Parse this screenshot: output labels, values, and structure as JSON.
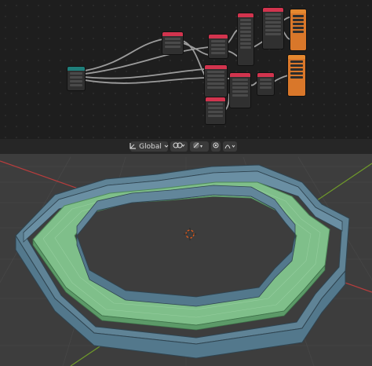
{
  "viewport_header": {
    "orientation": "Global",
    "icons": [
      "transform-orientation-icon",
      "chevron-down-icon",
      "pivot-point-icon",
      "snap-icon",
      "proportional-editing-icon",
      "falloff-curve-icon"
    ]
  },
  "colors": {
    "editor_background": "#1e1e1e",
    "geometry_node_header": "#d2344e",
    "input_node_header": "#1f7f7b",
    "output_node": "#d9772a",
    "viewport_background": "#3d3d3d",
    "wall_mesh": "#62869a",
    "track_mesh": "#7fbf8a",
    "x_axis": "#b83d3d",
    "y_axis": "#6f9a2a",
    "cursor": "#e05a1a"
  }
}
